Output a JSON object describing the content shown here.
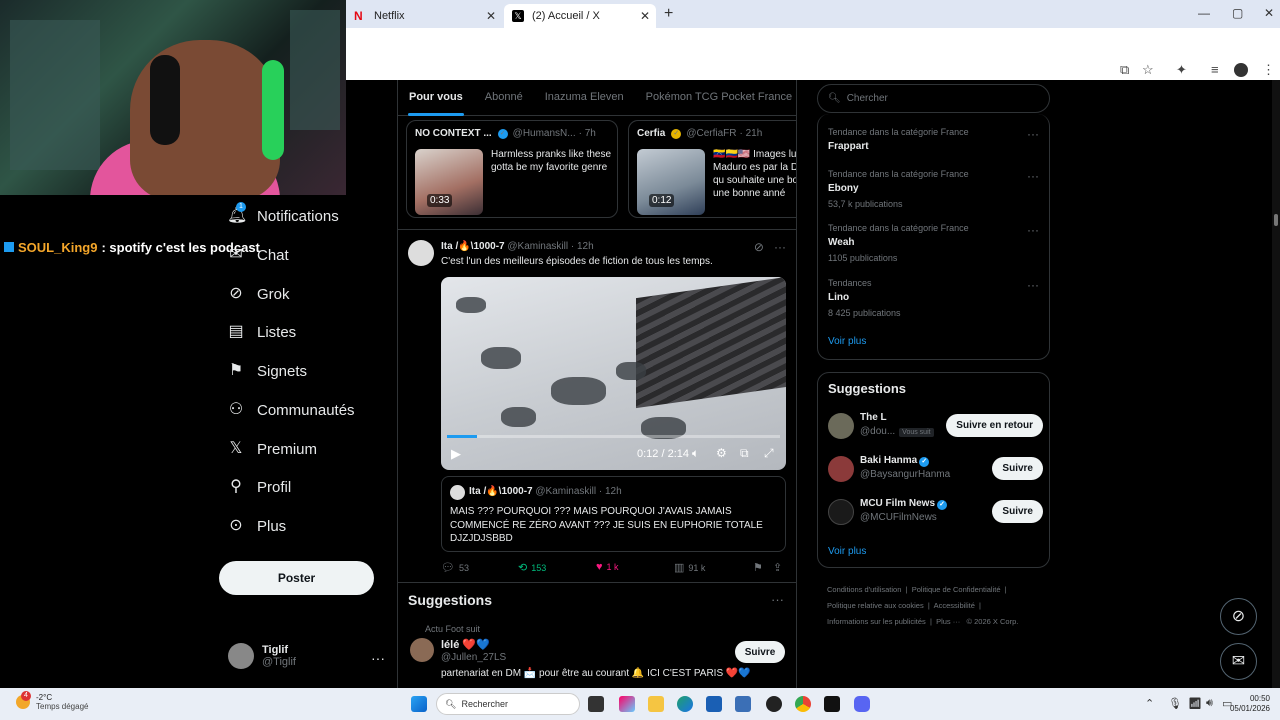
{
  "browser": {
    "tabs": [
      {
        "title": "Netflix",
        "favicon": "netflix-icon"
      },
      {
        "title": "(2) Accueil / X",
        "favicon": "x-icon",
        "active": true
      }
    ]
  },
  "chat": {
    "user": "SOUL_King9",
    "message": ": spotify c'est les podcast"
  },
  "nav": {
    "items": [
      {
        "label": "Notifications",
        "icon": "bell-icon"
      },
      {
        "label": "Chat",
        "icon": "mail-icon"
      },
      {
        "label": "Grok",
        "icon": "grok-icon"
      },
      {
        "label": "Listes",
        "icon": "list-icon"
      },
      {
        "label": "Signets",
        "icon": "bookmark-icon"
      },
      {
        "label": "Communautés",
        "icon": "communities-icon"
      },
      {
        "label": "Premium",
        "icon": "x-icon"
      },
      {
        "label": "Profil",
        "icon": "person-icon"
      },
      {
        "label": "Plus",
        "icon": "more-circle-icon"
      }
    ],
    "notification_badge": "1",
    "post_label": "Poster",
    "account": {
      "name": "Tiglif",
      "handle": "@Tiglif"
    }
  },
  "feed": {
    "tabs": [
      "Pour vous",
      "Abonné",
      "Inazuma Eleven",
      "Pokémon TCG Pocket France",
      "D("
    ],
    "cards": [
      {
        "name": "NO CONTEXT ...",
        "handle": "@HumansN...",
        "time": "· 7h",
        "text": "Harmless pranks like these gotta be my favorite genre",
        "duration": "0:33"
      },
      {
        "name": "Cerfia",
        "handle": "@CerfiaFR",
        "time": "· 21h",
        "text": "🇻🇪🇨🇴🇺🇸 Images lu Nicolas Maduro es par la DEA alors qu souhaite une bonn et une bonne anné",
        "duration": "0:12"
      }
    ],
    "tweet": {
      "name": "Ita /🔥\\1000-7",
      "handle": "@Kaminaskill",
      "time": "· 12h",
      "text": "C'est l'un des meilleurs épisodes de fiction de tous les temps.",
      "video": {
        "time": "0:12 / 2:14",
        "progress": 0.09
      },
      "quote": {
        "name": "Ita /🔥\\1000-7",
        "handle": "@Kaminaskill",
        "time": "· 12h",
        "text": "MAIS ??? POURQUOI ???  MAIS POURQUOI J'AVAIS JAMAIS COMMENCÉ RE ZÉRO AVANT ???  JE SUIS EN EUPHORIE TOTALE DJZJDJSBBD"
      },
      "actions": {
        "replies": "53",
        "reposts": "153",
        "likes": "1 k",
        "views": "91 k"
      }
    },
    "suggestion": {
      "title": "Suggestions",
      "context": "Actu Foot suit",
      "name": "lélé ❤️💙",
      "handle": "@Jullen_27LS",
      "text": "partenariat en DM 📩 pour être au courant 🔔 ICI C'EST PARIS ❤️💙",
      "button": "Suivre"
    }
  },
  "right": {
    "search_placeholder": "Chercher",
    "trends": [
      {
        "category": "Tendance dans la catégorie France",
        "name": "Frappart",
        "posts": ""
      },
      {
        "category": "Tendance dans la catégorie France",
        "name": "Ebony",
        "posts": "53,7 k publications"
      },
      {
        "category": "Tendance dans la catégorie France",
        "name": "Weah",
        "posts": "1105 publications"
      },
      {
        "category": "Tendances",
        "name": "Lino",
        "posts": "8 425 publications"
      }
    ],
    "see_more": "Voir plus",
    "wtf_title": "Suggestions",
    "who_to_follow": [
      {
        "name": "The L",
        "handle": "@dou...",
        "follows_you": "Vous suit",
        "button": "Suivre en retour",
        "verified": false
      },
      {
        "name": "Baki Hanma",
        "handle": "@BaysangurHanma",
        "follows_you": "",
        "button": "Suivre",
        "verified": true
      },
      {
        "name": "MCU Film News",
        "handle": "@MCUFilmNews",
        "follows_you": "",
        "button": "Suivre",
        "verified": true
      }
    ],
    "footer": [
      "Conditions d'utilisation",
      "Politique de Confidentialité",
      "Politique relative aux cookies",
      "Accessibilité",
      "Informations sur les publicités",
      "Plus ···",
      "© 2026 X Corp."
    ]
  },
  "taskbar": {
    "temp": "-2°C",
    "weather": "Temps dégagé",
    "weather_badge": "4",
    "search_label": "Rechercher",
    "time": "00:50",
    "date": "05/01/2026"
  }
}
